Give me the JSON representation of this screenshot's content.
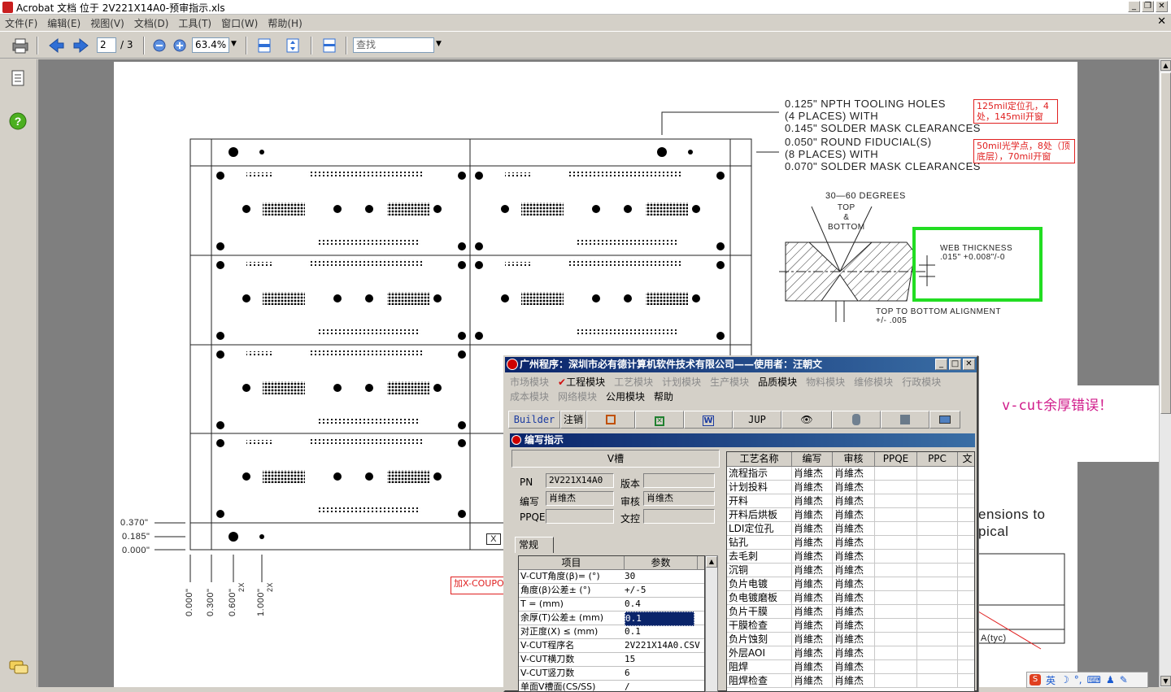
{
  "window": {
    "title": "Acrobat 文档 位于 2V221X14A0-预审指示.xls"
  },
  "menu": [
    "文件(F)",
    "编辑(E)",
    "视图(V)",
    "文档(D)",
    "工具(T)",
    "窗口(W)",
    "帮助(H)"
  ],
  "toolbar": {
    "page_current": "2",
    "page_total": "/ 3",
    "zoom": "63.4%",
    "find_placeholder": "查找"
  },
  "drawing": {
    "npth_note": [
      "0.125\" NPTH TOOLING HOLES",
      "(4 PLACES) WITH",
      "0.145\" SOLDER MASK CLEARANCES"
    ],
    "npth_cn": [
      "125mil定位孔，4",
      "处，145mil开窗"
    ],
    "fid_note": [
      "0.050\" ROUND FIDUCIAL(S)",
      "(8 PLACES) WITH",
      "0.070\" SOLDER MASK CLEARANCES"
    ],
    "fid_cn": [
      "50mil光学点，8处（顶",
      "底层），70mil开窗"
    ],
    "angle_note": "30—60 DEGREES",
    "top_bottom": [
      "TOP",
      "&",
      "BOTTOM"
    ],
    "web_thickness_title": "WEB THICKNESS",
    "web_thickness_value": ".015\" +0.008\"/-0",
    "alignment": [
      "TOP TO BOTTOM ALIGNMENT",
      "+/- .005"
    ],
    "left_dims": [
      "0.370\"",
      "0.185\"",
      "0.000\""
    ],
    "bottom_dims": [
      "0.000\"",
      "0.300\"",
      "0.600\"",
      "1.000\""
    ],
    "bottom_dims_x": [
      "2X",
      "2X"
    ],
    "coupon_note": "加X-COUPO",
    "x_label": "X",
    "partial_text": [
      "ensions to",
      "pical"
    ],
    "table_cell": "A(tyc)"
  },
  "annotation": {
    "vcut_error": "v-cut余厚错误！"
  },
  "erp": {
    "title": "广州程序：深圳市必有德计算机软件技术有限公司——使用者：汪朝文",
    "menu_row1": [
      "市场模块",
      "工程模块",
      "工艺模块",
      "计划模块",
      "生产模块",
      "品质模块",
      "物料模块",
      "维修模块",
      "行政模块"
    ],
    "menu_row2": [
      "成本模块",
      "网络模块",
      "公用模块",
      "帮助"
    ],
    "toolbar_builder": "Builder",
    "toolbar_logout": "注销",
    "toolbar_jup": "JUP",
    "sub_title": "编写指示",
    "panel_head": "V槽",
    "fields": {
      "pn_label": "PN",
      "pn_value": "2V221X14A0",
      "version_label": "版本",
      "version_value": "",
      "writer_label": "编写",
      "writer_value": "肖维杰",
      "review_label": "审核",
      "review_value": "肖维杰",
      "ppqe_label": "PPQE",
      "ppqe_value": "",
      "doc_label": "文控",
      "doc_value": ""
    },
    "tab": "常规",
    "param_headers": [
      "项目",
      "参数"
    ],
    "params": [
      {
        "item": "V-CUT角度(β)= (°)",
        "value": "30"
      },
      {
        "item": "角度(β)公差± (°)",
        "value": "+/-5"
      },
      {
        "item": "T = (mm)",
        "value": "0.4"
      },
      {
        "item": "余厚(T)公差± (mm)",
        "value": "0.1"
      },
      {
        "item": "对正度(X) ≤ (mm)",
        "value": "0.1"
      },
      {
        "item": "V-CUT程序名",
        "value": "2V221X14A0.CSV"
      },
      {
        "item": "V-CUT横刀数",
        "value": "15"
      },
      {
        "item": "V-CUT竖刀数",
        "value": "6"
      },
      {
        "item": "单面V槽面(CS/SS)",
        "value": "/"
      }
    ],
    "process_headers": [
      "工艺名称",
      "编写",
      "审核",
      "PPQE",
      "PPC",
      "文"
    ],
    "processes": [
      {
        "name": "流程指示",
        "writer": "肖維杰",
        "review": "肖維杰"
      },
      {
        "name": "计划投料",
        "writer": "肖維杰",
        "review": "肖維杰"
      },
      {
        "name": "开料",
        "writer": "肖維杰",
        "review": "肖維杰"
      },
      {
        "name": "开料后烘板",
        "writer": "肖維杰",
        "review": "肖維杰"
      },
      {
        "name": "LDI定位孔",
        "writer": "肖維杰",
        "review": "肖維杰"
      },
      {
        "name": "钻孔",
        "writer": "肖維杰",
        "review": "肖維杰"
      },
      {
        "name": "去毛刺",
        "writer": "肖維杰",
        "review": "肖維杰"
      },
      {
        "name": "沉铜",
        "writer": "肖維杰",
        "review": "肖維杰"
      },
      {
        "name": "负片电镀",
        "writer": "肖維杰",
        "review": "肖維杰"
      },
      {
        "name": "负电镀磨板",
        "writer": "肖維杰",
        "review": "肖維杰"
      },
      {
        "name": "负片干膜",
        "writer": "肖維杰",
        "review": "肖維杰"
      },
      {
        "name": "干膜检查",
        "writer": "肖維杰",
        "review": "肖維杰"
      },
      {
        "name": "负片蚀刻",
        "writer": "肖維杰",
        "review": "肖維杰"
      },
      {
        "name": "外层AOI",
        "writer": "肖維杰",
        "review": "肖維杰"
      },
      {
        "name": "阻焊",
        "writer": "肖維杰",
        "review": "肖維杰"
      },
      {
        "name": "阻焊检查",
        "writer": "肖維杰",
        "review": "肖維杰"
      }
    ]
  },
  "ime": {
    "lang": "英"
  },
  "colors": {
    "accent_red": "#e02020",
    "green_box": "#22dd22",
    "titlebar_blue": "#0a246a",
    "error_magenta": "#d01a8a"
  }
}
